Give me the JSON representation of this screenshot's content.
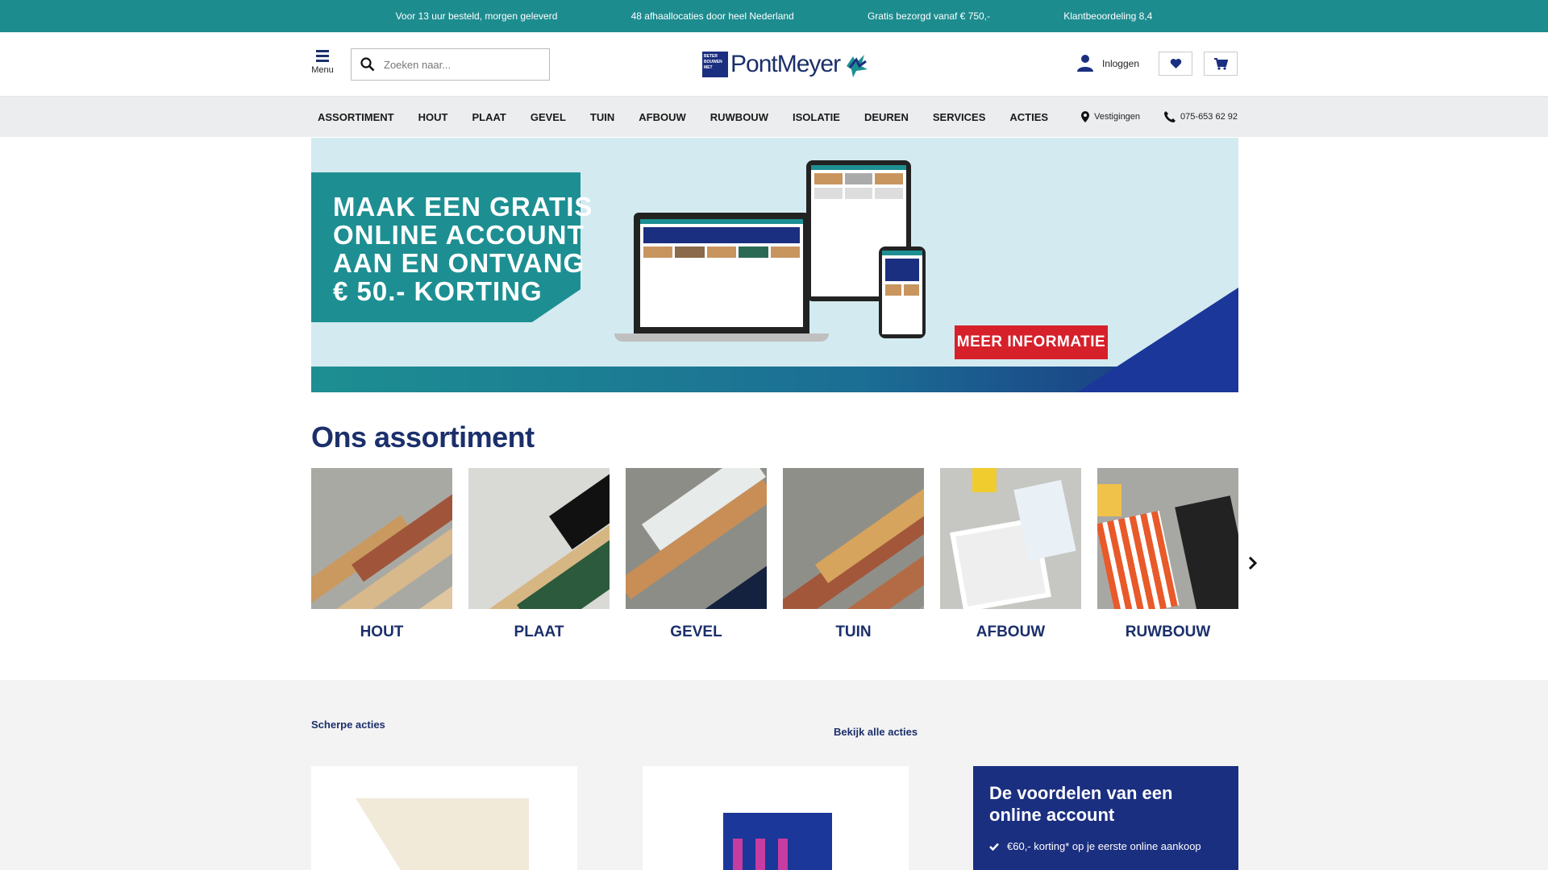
{
  "topbar": {
    "usps": [
      "Voor 13 uur besteld, morgen geleverd",
      "48 afhaallocaties door heel Nederland",
      "Gratis bezorgd vanaf € 750,-",
      "Klantbeoordeling 8,4"
    ]
  },
  "header": {
    "menu_label": "Menu",
    "search_placeholder": "Zoeken naar...",
    "logo_badge": "BETER BOUWEN MET",
    "logo_text": "PontMeyer",
    "login_label": "Inloggen"
  },
  "nav": {
    "items": [
      "ASSORTIMENT",
      "HOUT",
      "PLAAT",
      "GEVEL",
      "TUIN",
      "AFBOUW",
      "RUWBOUW",
      "ISOLATIE",
      "DEUREN",
      "SERVICES",
      "ACTIES"
    ],
    "locations_label": "Vestigingen",
    "phone": "075-653 62 92"
  },
  "banner": {
    "headline_lines": [
      "MAAK EEN GRATIS",
      "ONLINE ACCOUNT",
      "AAN EN ONTVANG",
      "€ 50.- KORTING"
    ],
    "cta_label": "MEER INFORMATIE"
  },
  "assortment": {
    "title": "Ons assortiment",
    "categories": [
      {
        "label": "HOUT"
      },
      {
        "label": "PLAAT"
      },
      {
        "label": "GEVEL"
      },
      {
        "label": "TUIN"
      },
      {
        "label": "AFBOUW"
      },
      {
        "label": "RUWBOUW"
      }
    ]
  },
  "deals": {
    "title": "Scherpe acties",
    "view_all": "Bekijk alle acties"
  },
  "account_box": {
    "title": "De voordelen van een online account",
    "benefits": [
      "€60,- korting* op je eerste online aankoop"
    ]
  },
  "colors": {
    "teal": "#1d8c8f",
    "navy": "#1b2f6b",
    "red": "#d6202a"
  }
}
